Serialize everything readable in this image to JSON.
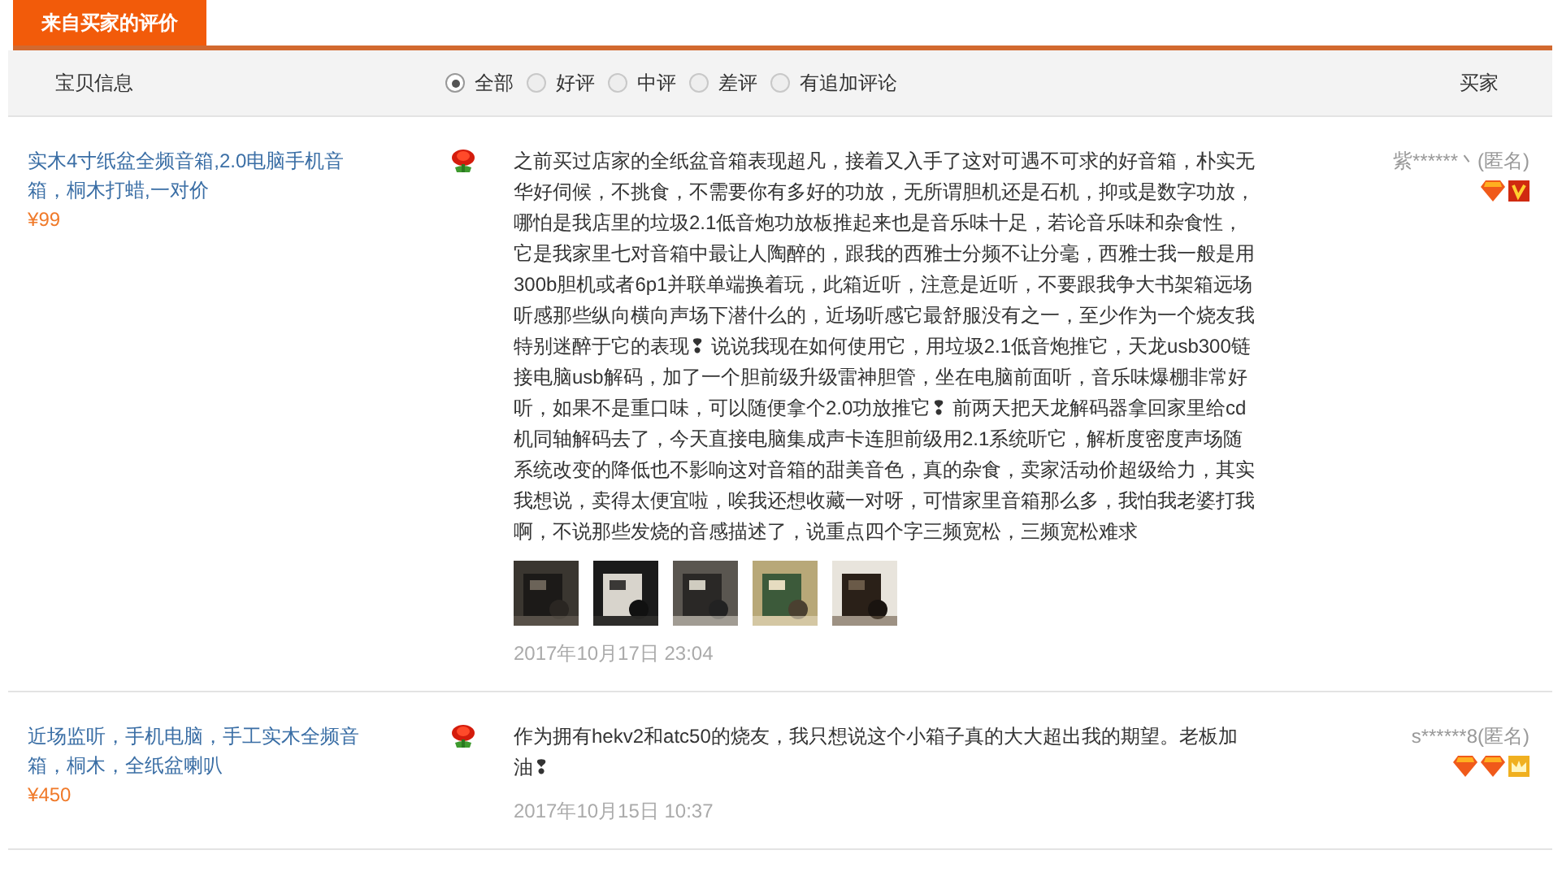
{
  "tab": {
    "label": "来自买家的评价"
  },
  "header": {
    "item_label": "宝贝信息",
    "buyer_label": "买家",
    "filters": [
      {
        "label": "全部",
        "selected": true
      },
      {
        "label": "好评",
        "selected": false
      },
      {
        "label": "中评",
        "selected": false
      },
      {
        "label": "差评",
        "selected": false
      },
      {
        "label": "有追加评论",
        "selected": false
      }
    ]
  },
  "reviews": [
    {
      "product": "实木4寸纸盆全频音箱,2.0电脑手机音箱，桐木打蜡,一对价",
      "currency": "¥",
      "price": "99",
      "text": "之前买过店家的全纸盆音箱表现超凡，接着又入手了这对可遇不可求的好音箱，朴实无华好伺候，不挑食，不需要你有多好的功放，无所谓胆机还是石机，抑或是数字功放，哪怕是我店里的垃圾2.1低音炮功放板推起来也是音乐味十足，若论音乐味和杂食性，它是我家里七对音箱中最让人陶醉的，跟我的西雅士分频不让分毫，西雅士我一般是用300b胆机或者6p1并联单端换着玩，此箱近听，注意是近听，不要跟我争大书架箱远场听感那些纵向横向声场下潜什么的，近场听感它最舒服没有之一，至少作为一个烧友我特别迷醉于它的表现❢ 说说我现在如何使用它，用垃圾2.1低音炮推它，天龙usb300链接电脑usb解码，加了一个胆前级升级雷神胆管，坐在电脑前面听，音乐味爆棚非常好听，如果不是重口味，可以随便拿个2.0功放推它❢ 前两天把天龙解码器拿回家里给cd机同轴解码去了，今天直接电脑集成声卡连胆前级用2.1系统听它，解析度密度声场随系统改变的降低也不影响这对音箱的甜美音色，真的杂食，卖家活动价超级给力，其实我想说，卖得太便宜啦，唉我还想收藏一对呀，可惜家里音箱那么多，我怕我老婆打我啊，不说那些发烧的音感描述了，说重点四个字三频宽松，三频宽松难求",
      "photos": [
        {
          "kind": "picture"
        },
        {
          "kind": "picture"
        },
        {
          "kind": "picture"
        },
        {
          "kind": "picture"
        },
        {
          "kind": "picture"
        }
      ],
      "date": "2017年10月17日 23:04",
      "buyer": "紫******丶(匿名)",
      "badges": [
        {
          "kind": "diamond"
        },
        {
          "kind": "vip"
        }
      ]
    },
    {
      "product": "近场监听，手机电脑，手工实木全频音箱，桐木，全纸盆喇叭",
      "currency": "¥",
      "price": "450",
      "text": "作为拥有hekv2和atc50的烧友，我只想说这个小箱子真的大大超出我的期望。老板加油❢",
      "date": "2017年10月15日 10:37",
      "buyer": "s******8(匿名)",
      "badges": [
        {
          "kind": "diamond"
        },
        {
          "kind": "diamond"
        },
        {
          "kind": "crown"
        }
      ]
    }
  ]
}
